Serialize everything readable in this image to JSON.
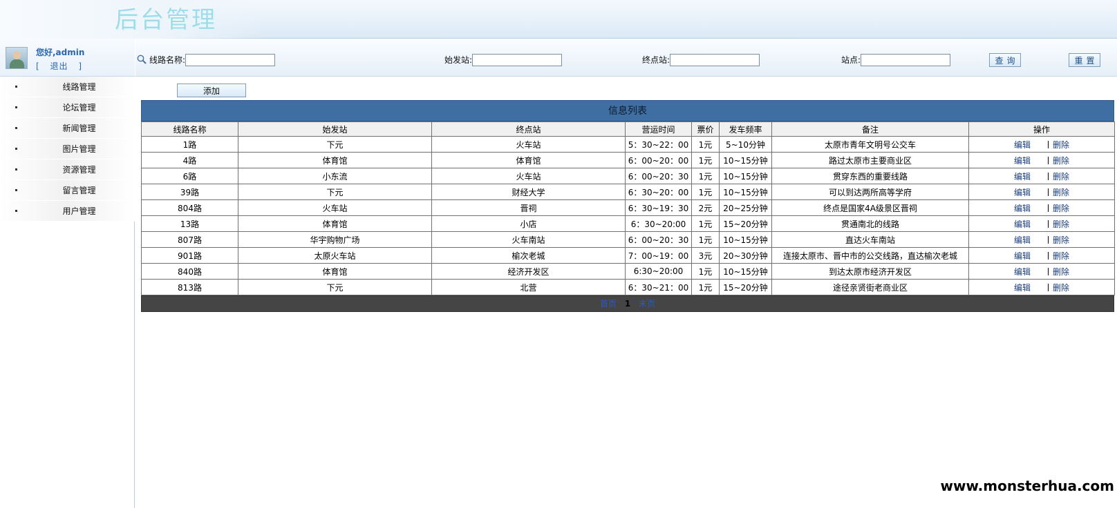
{
  "header": {
    "title": "后台管理"
  },
  "user": {
    "greeting": "您好,admin",
    "logout_open": "[",
    "logout_label": "退出",
    "logout_close": "]"
  },
  "sidebar": {
    "items": [
      {
        "label": "线路管理"
      },
      {
        "label": "论坛管理"
      },
      {
        "label": "新闻管理"
      },
      {
        "label": "图片管理"
      },
      {
        "label": "资源管理"
      },
      {
        "label": "留言管理"
      },
      {
        "label": "用户管理"
      }
    ]
  },
  "search": {
    "route_name_label": "线路名称:",
    "start_label": "始发站:",
    "end_label": "终点站:",
    "stop_label": "站点:",
    "route_name_value": "",
    "start_value": "",
    "end_value": "",
    "stop_value": "",
    "query_button": "查询",
    "reset_button": "重置"
  },
  "actions": {
    "add_button": "添加"
  },
  "table": {
    "title": "信息列表",
    "headers": [
      "线路名称",
      "始发站",
      "终点站",
      "营运时间",
      "票价",
      "发车频率",
      "备注",
      "操作"
    ],
    "rows": [
      {
        "name": "1路",
        "start": "下元",
        "end": "火车站",
        "hours": "5：30~22：00",
        "fare": "1元",
        "freq": "5~10分钟",
        "note": "太原市青年文明号公交车"
      },
      {
        "name": "4路",
        "start": "体育馆",
        "end": "体育馆",
        "hours": "6：00~20：00",
        "fare": "1元",
        "freq": "10~15分钟",
        "note": "路过太原市主要商业区"
      },
      {
        "name": "6路",
        "start": "小东流",
        "end": "火车站",
        "hours": "6：00~20：30",
        "fare": "1元",
        "freq": "10~15分钟",
        "note": "贯穿东西的重要线路"
      },
      {
        "name": "39路",
        "start": "下元",
        "end": "财经大学",
        "hours": "6：30~20：00",
        "fare": "1元",
        "freq": "10~15分钟",
        "note": "可以到达两所高等学府"
      },
      {
        "name": "804路",
        "start": "火车站",
        "end": "晋祠",
        "hours": "6：30~19：30",
        "fare": "2元",
        "freq": "20~25分钟",
        "note": "终点是国家4A级景区晋祠"
      },
      {
        "name": "13路",
        "start": "体育馆",
        "end": "小店",
        "hours": "6：30~20:00",
        "fare": "1元",
        "freq": "15~20分钟",
        "note": "贯通南北的线路"
      },
      {
        "name": "807路",
        "start": "华宇购物广场",
        "end": "火车南站",
        "hours": "6：00~20：30",
        "fare": "1元",
        "freq": "10~15分钟",
        "note": "直达火车南站"
      },
      {
        "name": "901路",
        "start": "太原火车站",
        "end": "榆次老城",
        "hours": "7：00~19：00",
        "fare": "3元",
        "freq": "20~30分钟",
        "note": "连接太原市、晋中市的公交线路，直达榆次老城"
      },
      {
        "name": "840路",
        "start": "体育馆",
        "end": "经济开发区",
        "hours": "6:30~20:00",
        "fare": "1元",
        "freq": "10~15分钟",
        "note": "到达太原市经济开发区"
      },
      {
        "name": "813路",
        "start": "下元",
        "end": "北营",
        "hours": "6：30~21：00",
        "fare": "1元",
        "freq": "15~20分钟",
        "note": "途径亲贤街老商业区"
      }
    ],
    "edit_label": "编辑",
    "delete_label": "删除"
  },
  "pager": {
    "first": "首页",
    "current": "1",
    "last": "末页"
  },
  "watermark": "www.monsterhua.com",
  "colors": {
    "table_title_bg": "#3f6ea3",
    "pager_bg": "#454545",
    "link": "#1a3d7c",
    "banner_title": "#9fdce9"
  }
}
